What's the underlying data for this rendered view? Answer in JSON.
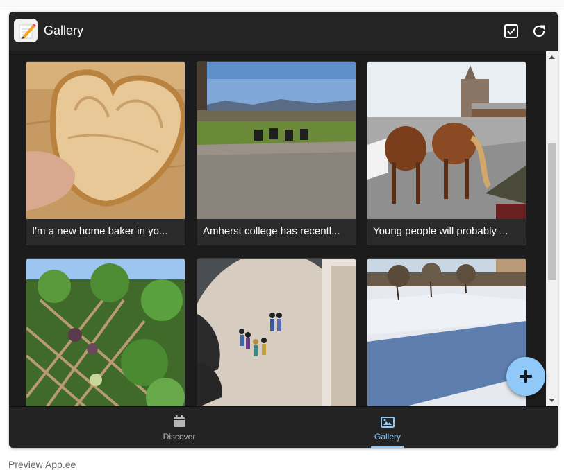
{
  "app": {
    "title": "Gallery"
  },
  "gallery": {
    "cards": [
      {
        "caption": "I'm a new home baker in yo..."
      },
      {
        "caption": "Amherst college has recentl..."
      },
      {
        "caption": "Young people will probably ..."
      },
      {
        "caption": ""
      },
      {
        "caption": ""
      },
      {
        "caption": ""
      }
    ]
  },
  "nav": {
    "discover": "Discover",
    "gallery": "Gallery",
    "active": "gallery"
  },
  "footer": {
    "text": "Preview App.ee"
  },
  "colors": {
    "accent": "#90c8f8",
    "surface": "#242424",
    "background": "#1c1c1c",
    "inactive_nav": "#b5b5b5"
  },
  "icons": {
    "app": "notepad-pencil-icon",
    "select": "checkbox-icon",
    "refresh": "refresh-icon",
    "add": "plus-icon",
    "discover": "calendar-icon",
    "gallery": "image-icon"
  }
}
